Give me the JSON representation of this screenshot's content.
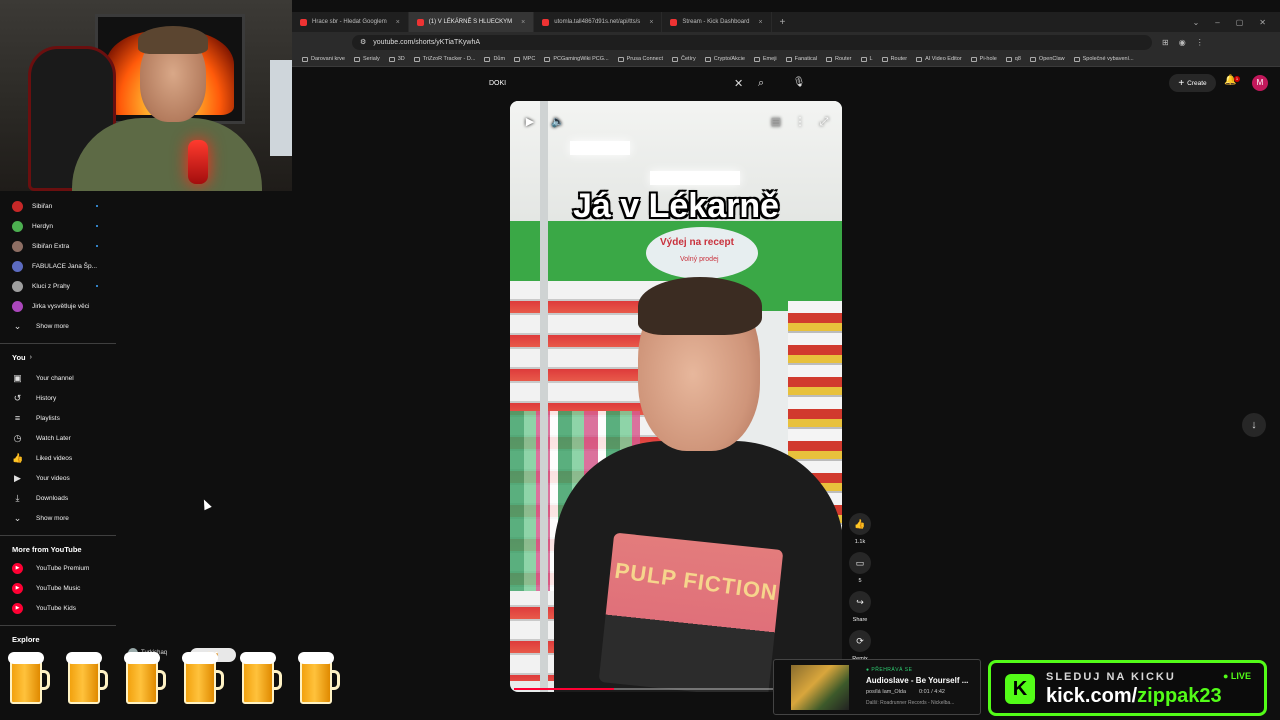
{
  "browser": {
    "tabs": [
      {
        "label": "Hrace sbr - Hledat Googlem",
        "active": false
      },
      {
        "label": "(1) V LÉKÁRNĚ S HLUECKYM",
        "active": true
      },
      {
        "label": "utomla.tall4867d91s.net/api/tts/s",
        "active": false
      },
      {
        "label": "Stream - Kick Dashboard",
        "active": false
      }
    ],
    "url": "youtube.com/shorts/yKTiaTKywhA",
    "bookmarks": [
      "Darovani krve",
      "Serialy",
      "3D",
      "TriZzoR Tracker - D...",
      "Dům",
      "MPC",
      "PCGamingWiki PCG...",
      "Prusa Connect",
      "Četíry",
      "Crypto/Akcie",
      "Emeji",
      "Fanatical",
      "Router",
      "L",
      "Router",
      "AI Video Editor",
      "Pi-hole",
      "q8",
      "OpenClaw",
      "Společné vybavení..."
    ]
  },
  "sidebar": {
    "subscriptions": [
      {
        "name": "Sibiřan",
        "color": "#c62828",
        "dot": true
      },
      {
        "name": "Herdyn",
        "color": "#4caf50",
        "dot": true
      },
      {
        "name": "Sibiřan Extra",
        "color": "#8d6e63",
        "dot": true
      },
      {
        "name": "FABULACE Jana Šp...",
        "color": "#5c6bc0",
        "dot": false
      },
      {
        "name": "Kluci z Prahy",
        "color": "#9e9e9e",
        "dot": true
      },
      {
        "name": "Jirka vysvětluje věci",
        "color": "#ab47bc",
        "dot": false
      }
    ],
    "show_more_1": "Show more",
    "you_label": "You",
    "you_items": [
      {
        "label": "Your channel",
        "icon": "▣"
      },
      {
        "label": "History",
        "icon": "↺"
      },
      {
        "label": "Playlists",
        "icon": "≡"
      },
      {
        "label": "Watch Later",
        "icon": "◷"
      },
      {
        "label": "Liked videos",
        "icon": "👍"
      },
      {
        "label": "Your videos",
        "icon": "▶"
      },
      {
        "label": "Downloads",
        "icon": "⤓"
      }
    ],
    "show_more_2": "Show more",
    "more_label": "More from YouTube",
    "more_items": [
      "YouTube Premium",
      "YouTube Music",
      "YouTube Kids"
    ],
    "explore_label": "Explore"
  },
  "header": {
    "search_value": "DOKI",
    "create_label": "Create",
    "bell_badge": "1",
    "avatar_letter": "M"
  },
  "short": {
    "caption": "Já v Lékarně",
    "sign_line1": "Výdej na recept",
    "sign_line2": "Volný prodej",
    "shirt_text": "PULP FICTION",
    "progress": 0.31
  },
  "actions": {
    "likes": "1.1k",
    "comments": "5",
    "share": "Share",
    "remix": "Remix"
  },
  "overlay": {
    "chat_user": "Turkishaq",
    "beer_tag": "🍺 🍺",
    "beer_count": 6
  },
  "now_playing": {
    "label": "● PŘEHRÁVÁ SE",
    "title": "Audioslave - Be Yourself ...",
    "requested_by": "posílá Iam_Olda",
    "time": "0:01 / 4:42",
    "next": "Další: Roadrunner Records - Nickelba..."
  },
  "kick": {
    "logo_letter": "K",
    "line1": "SLEDUJ NA KICKU",
    "line2_prefix": "kick.com/",
    "line2_handle": "zippak23",
    "live": "● LIVE"
  }
}
